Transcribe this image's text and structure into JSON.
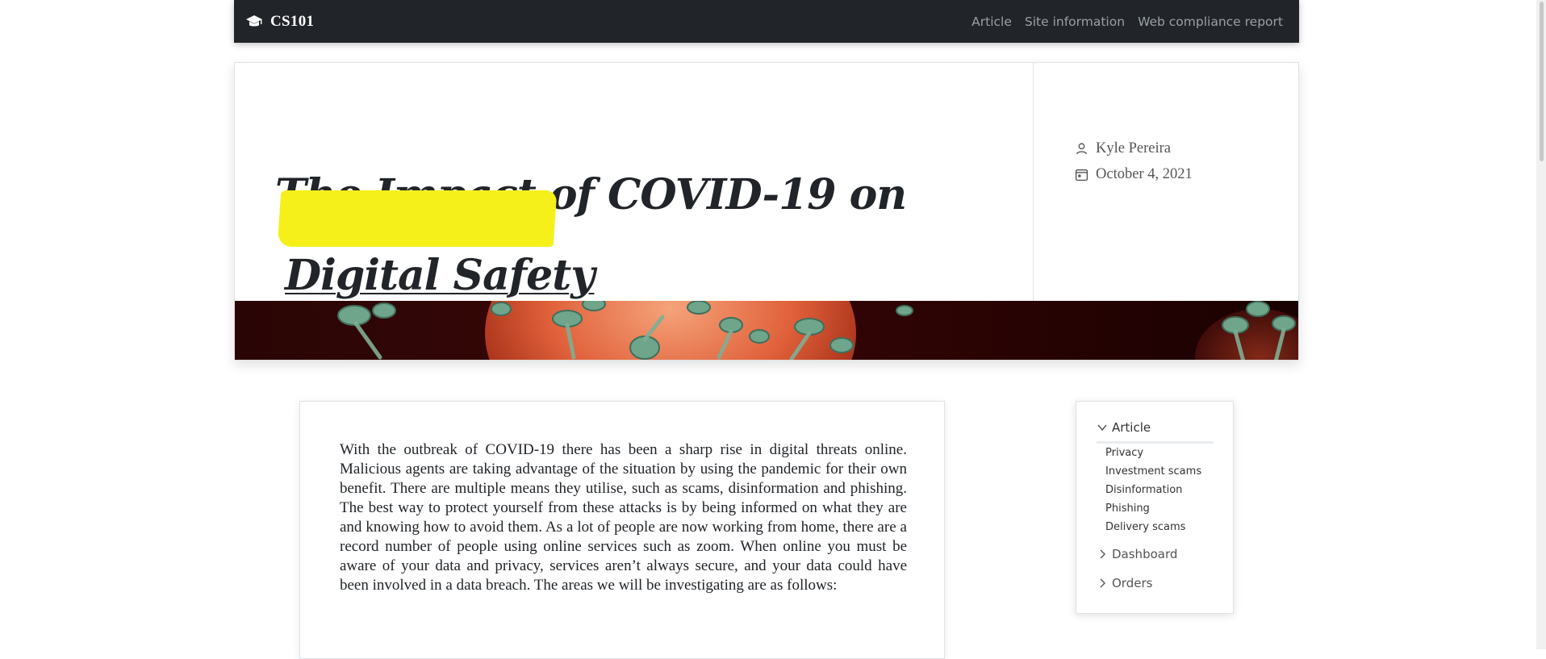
{
  "navbar": {
    "brand": "CS101",
    "brand_icon": "graduation-cap-icon",
    "links": [
      "Article",
      "Site information",
      "Web compliance report"
    ]
  },
  "header": {
    "title_line1": "The Impact of COVID-19 on",
    "title_line2": "Digital Safety",
    "author": "Kyle Pereira",
    "date": "October 4, 2021",
    "highlight_color": "#f5f01a"
  },
  "article": {
    "intro": "With the outbreak of COVID-19 there has been a sharp rise in digital threats online. Malicious agents are taking advantage of the situation by using the pandemic for their own benefit. There are multiple means they utilise, such as scams, disinformation and phishing. The best way to protect yourself from these attacks is by being informed on what they are and knowing how to avoid them. As a lot of people are now working from home, there are a record number of people using online services such as zoom. When online you must be aware of your data and privacy, services aren’t always secure, and your data could have been involved in a data breach. The areas we will be investigating are as follows:"
  },
  "sidebar": {
    "sections": [
      {
        "label": "Article",
        "items": [
          "Privacy",
          "Investment scams",
          "Disinformation",
          "Phishing",
          "Delivery scams"
        ]
      },
      {
        "label": "Dashboard"
      },
      {
        "label": "Orders"
      }
    ]
  },
  "colors": {
    "navbar_bg": "#212529",
    "nav_link": "#9aa0a6",
    "banner_dark": "#2a0505"
  }
}
